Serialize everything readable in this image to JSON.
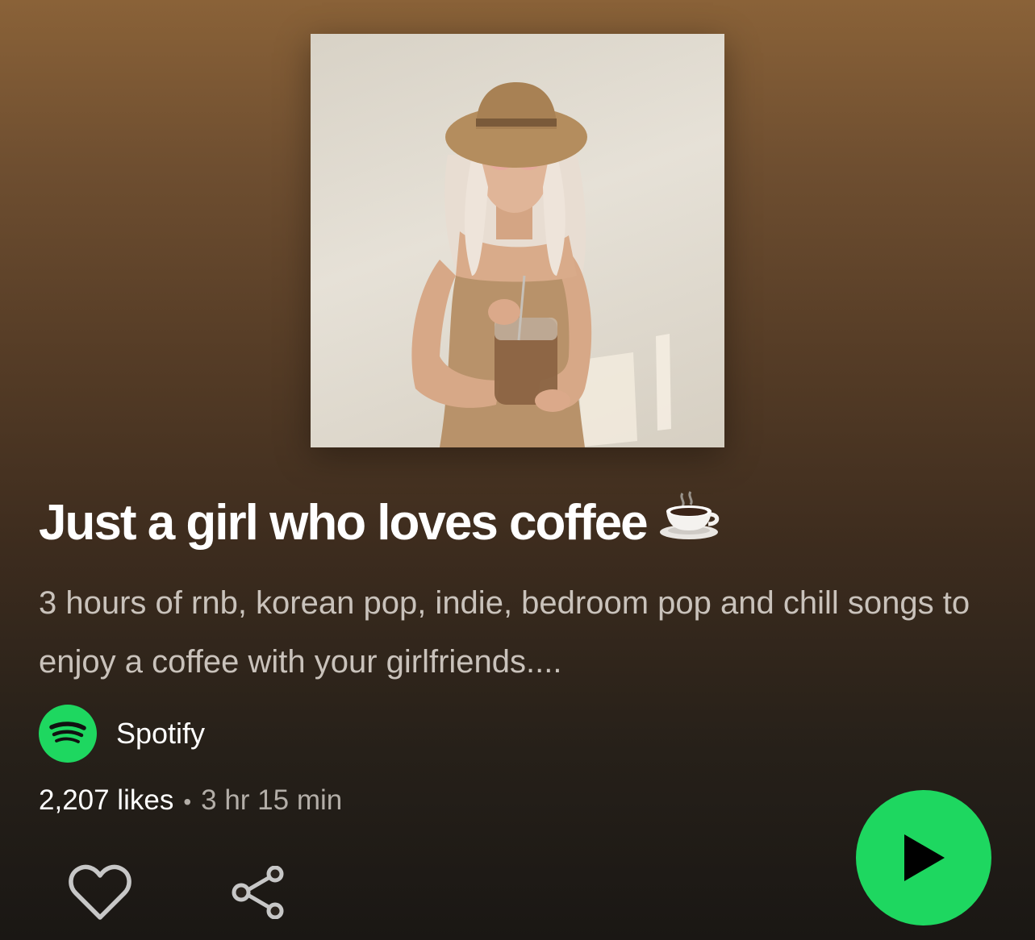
{
  "playlist": {
    "cover_image": "woman-with-iced-coffee-cover",
    "title": "Just a girl who loves coffee",
    "title_emoji": "coffee-cup-icon",
    "description": "3 hours of rnb, korean pop, indie, bedroom pop and chill songs to enjoy a coffee with your girlfriends....",
    "owner": {
      "name": "Spotify",
      "icon": "spotify-logo-icon"
    },
    "likes": "2,207 likes",
    "separator": "•",
    "duration": "3 hr 15 min"
  },
  "actions": {
    "like_icon": "heart-icon",
    "share_icon": "share-icon",
    "play_icon": "play-icon"
  },
  "colors": {
    "accent": "#1ed760",
    "background_top": "#8a6238",
    "background_bottom": "#1a1714",
    "secondary_text": "#c9c2bb"
  }
}
